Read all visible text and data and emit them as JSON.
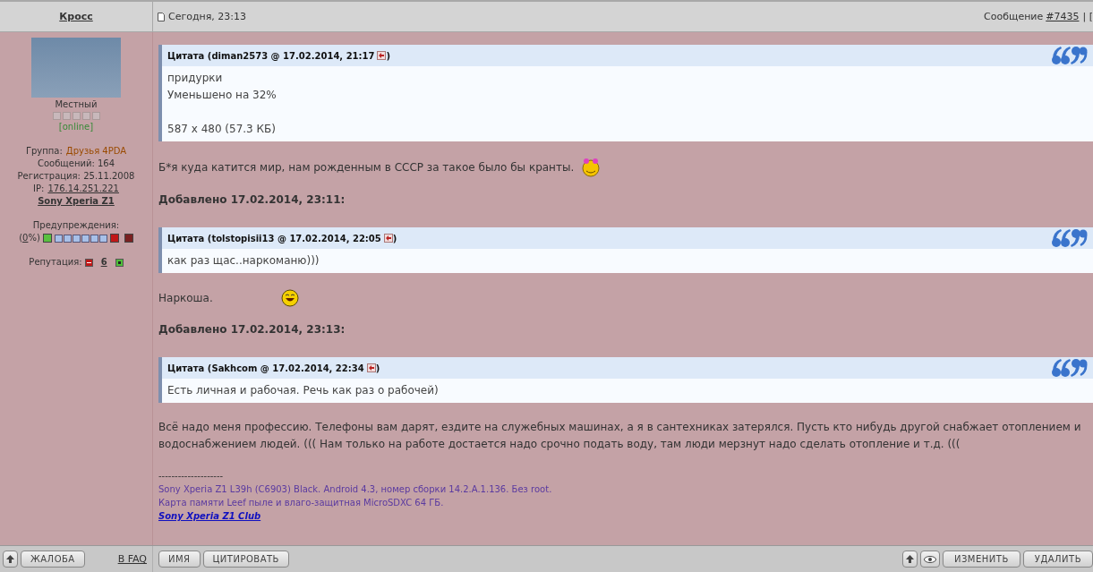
{
  "author": {
    "name": "Кросс",
    "rank": "Местный",
    "stars": 0,
    "status": "[online]",
    "group_label": "Группа:",
    "group": "Друзья 4PDA",
    "posts": "Сообщений: 164",
    "registered": "Регистрация: 25.11.2008",
    "ip_label": "IP:",
    "ip": "176.14.251.221",
    "device": "Sony Xperia Z1",
    "warnings_label": "Предупреждения:",
    "warning_open": "(",
    "warning_percent": "0",
    "warning_close": "%)",
    "warnings": {
      "level": 0
    },
    "reputation_label": "Репутация:",
    "reputation": "6"
  },
  "post": {
    "date": "Сегодня, 23:13",
    "number_label": "Сообщение",
    "number": "#7435",
    "tail": "| [",
    "blocks": [
      {
        "kind": "quote",
        "title": "Цитата (diman2573 @ 17.02.2014, 21:17",
        "close": ")",
        "lines": [
          {
            "text": "придурки",
            "spaced": false
          },
          {
            "text": " Уменьшено на 32%",
            "spaced": false
          },
          {
            "text": "587 x 480 (57.3 КБ)",
            "spaced": true
          }
        ]
      },
      {
        "kind": "blush",
        "text": "Б*я куда катится мир, нам рожденным в СССР за такое было бы кранты."
      },
      {
        "kind": "added",
        "text": "Добавлено 17.02.2014, 23:11:"
      },
      {
        "kind": "quote",
        "title": "Цитата (tolstopisii13 @ 17.02.2014, 22:05",
        "close": ")",
        "lines": [
          {
            "text": "как раз щас..наркоманю)))",
            "spaced": false
          }
        ]
      },
      {
        "kind": "laugh",
        "text": "Наркоша."
      },
      {
        "kind": "added",
        "text": "Добавлено 17.02.2014, 23:13:"
      },
      {
        "kind": "quote",
        "title": "Цитата (Sakhcom @ 17.02.2014, 22:34",
        "close": ")",
        "lines": [
          {
            "text": "Есть личная и рабочая. Речь как раз о рабочей)",
            "spaced": false
          }
        ]
      },
      {
        "kind": "text",
        "text": "Всё надо меня профессию. Телефоны вам дарят, ездите на служебных машинах, а я в сантехниках затерялся. Пусть кто нибудь другой снабжает отоплением и водоснабжением людей. ((( Нам только на работе достается надо срочно подать воду, там люди мерзнут надо сделать отопление и т.д. ((("
      }
    ],
    "signature": {
      "rule": "--------------------",
      "lines": [
        "Sony Xperia Z1 L39h (C6903) Black. Android 4.3, номер сборки 14.2.A.1.136. Без root.",
        "Карта памяти Leef пыле и влаго-защитная MicroSDXC 64 ГБ."
      ],
      "link": "Sony Xperia Z1 Club"
    }
  },
  "footer": {
    "left_buttons": [
      "ЖАЛОБА"
    ],
    "faq": "В FAQ",
    "mid_buttons": [
      "ИМЯ",
      "ЦИТИРОВАТЬ"
    ],
    "right_buttons": [
      "ИЗМЕНИТЬ",
      "УДАЛИТЬ"
    ]
  }
}
